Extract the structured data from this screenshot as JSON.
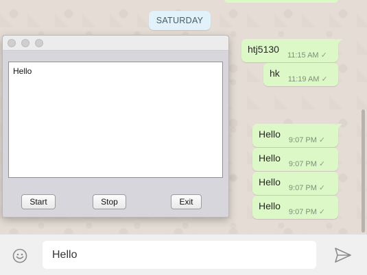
{
  "chat": {
    "date_label": "SATURDAY",
    "messages": [
      {
        "text": "htj5130",
        "time": "11:15 AM",
        "check": "✓"
      },
      {
        "text": "hk",
        "time": "11:19 AM",
        "check": "✓"
      },
      {
        "text": "Hello",
        "time": "9:07 PM",
        "check": "✓"
      },
      {
        "text": "Hello",
        "time": "9:07 PM",
        "check": "✓"
      },
      {
        "text": "Hello",
        "time": "9:07 PM",
        "check": "✓"
      },
      {
        "text": "Hello",
        "time": "9:07 PM",
        "check": "✓"
      }
    ]
  },
  "app_window": {
    "text_area_value": "Hello",
    "start_label": "Start",
    "stop_label": "Stop",
    "exit_label": "Exit"
  },
  "composer": {
    "input_value": "Hello",
    "emoji_icon": "smiley-icon",
    "send_icon": "send-icon"
  },
  "colors": {
    "bubble": "#dcf8c6",
    "chat_background": "#e5ddd5",
    "date_pill": "#e1f2fb"
  }
}
